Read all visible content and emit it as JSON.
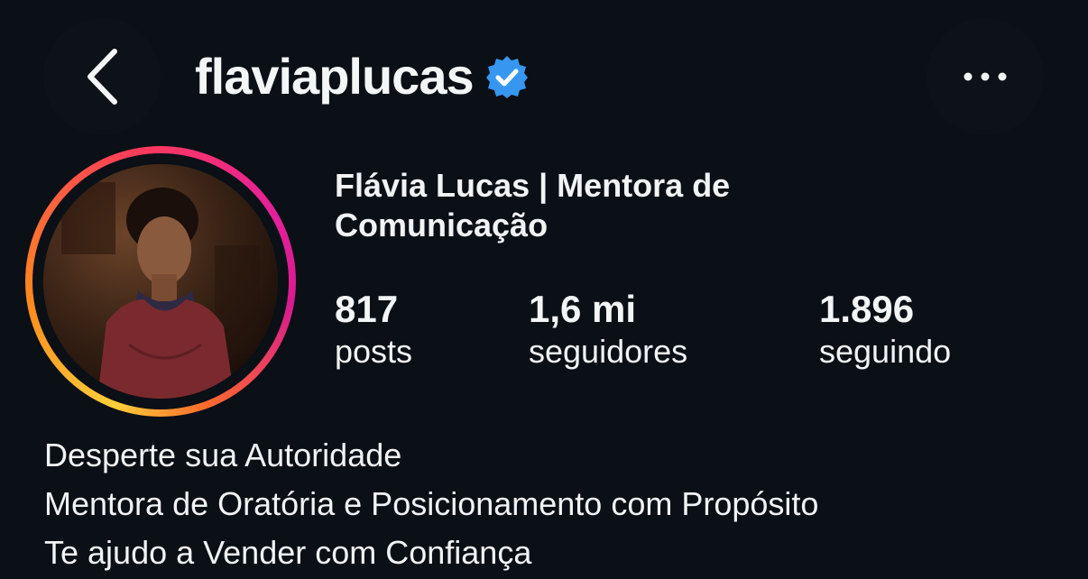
{
  "header": {
    "back_icon": "chevron-left-icon",
    "username": "flaviaplucas",
    "verified_icon": "verified-badge-icon",
    "more_icon": "more-horizontal-icon"
  },
  "profile": {
    "display_name": "Flávia Lucas | Mentora de Comunicação",
    "stats": [
      {
        "value": "817",
        "label": "posts"
      },
      {
        "value": "1,6 mi",
        "label": "seguidores"
      },
      {
        "value": "1.896",
        "label": "seguindo"
      }
    ],
    "bio": [
      "Desperte sua Autoridade",
      "Mentora de Oratória e Posicionamento com Propósito",
      "Te ajudo a Vender com Confiança"
    ]
  },
  "colors": {
    "background": "#0b0f16",
    "text": "#f2f3f5",
    "verified_blue": "#3797f0",
    "story_ring_gradient": [
      "#ffcf3a",
      "#ff8a1c",
      "#ff3b5c",
      "#e41f9a"
    ]
  }
}
